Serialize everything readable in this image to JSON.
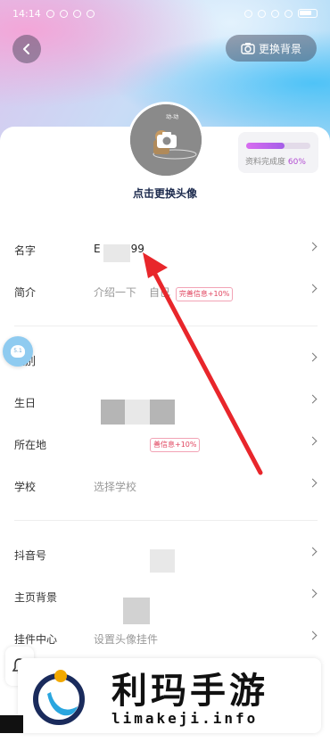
{
  "status_bar": {
    "time": "14:14",
    "battery_level": 0.7
  },
  "header": {
    "change_bg_label": "更换背景"
  },
  "avatar": {
    "caption": "点击更换头像",
    "art_text": "动-动"
  },
  "profile_completion": {
    "label": "资料完成度",
    "percent_text": "60%",
    "value": 0.6
  },
  "rows": {
    "name": {
      "label": "名字",
      "value": "E",
      "value2": "99"
    },
    "bio": {
      "label": "简介",
      "value": "介绍一下",
      "value2": "自己",
      "badge": "完善信息+10%"
    },
    "gender": {
      "label": "性别"
    },
    "birthday": {
      "label": "生日"
    },
    "location": {
      "label": "所在地",
      "badge": "善信息+10%"
    },
    "school": {
      "label": "学校",
      "value": "选择学校"
    },
    "douyin_id": {
      "label": "抖音号"
    },
    "home_bg": {
      "label": "主页背景"
    },
    "pendant": {
      "label": "挂件中心",
      "value": "设置头像挂件"
    }
  },
  "float_bubble": {
    "text": "5.1"
  },
  "watermark": {
    "title": "利玛手游",
    "url": "limakeji.info"
  },
  "colors": {
    "accent_badge": "#e0455f",
    "progress": "#b14bd1",
    "arrow": "#e8262b"
  }
}
